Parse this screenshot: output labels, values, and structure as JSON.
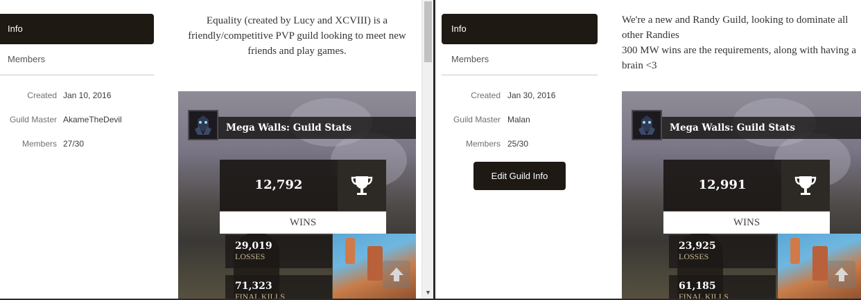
{
  "left_guild": {
    "nav": {
      "info_label": "Info",
      "members_label": "Members"
    },
    "meta": [
      {
        "key": "Created",
        "value": "Jan 10, 2016"
      },
      {
        "key": "Guild Master",
        "value": "AkameTheDevil"
      },
      {
        "key": "Members",
        "value": "27/30"
      }
    ],
    "description": "Equality (created by Lucy and XCVIII) is a friendly/competitive PVP guild looking to meet new friends and play games.",
    "stats_card": {
      "title": "Mega Walls: Guild Stats",
      "wins_value": "12,792",
      "wins_label": "WINS",
      "losses_value": "29,019",
      "losses_label": "LOSSES",
      "final_kills_value": "71,323",
      "final_kills_label": "FINAL KILLS"
    }
  },
  "right_guild": {
    "nav": {
      "info_label": "Info",
      "members_label": "Members"
    },
    "meta": [
      {
        "key": "Created",
        "value": "Jan 30, 2016"
      },
      {
        "key": "Guild Master",
        "value": "Malan"
      },
      {
        "key": "Members",
        "value": "25/30"
      }
    ],
    "edit_button_label": "Edit Guild Info",
    "description_lines": [
      "We're a new and Randy Guild, looking to dominate all other Randies",
      "300 MW wins are the requirements, along with having a brain <3"
    ],
    "stats_card": {
      "title": "Mega Walls: Guild Stats",
      "wins_value": "12,991",
      "wins_label": "WINS",
      "losses_value": "23,925",
      "losses_label": "LOSSES",
      "final_kills_value": "61,185",
      "final_kills_label": "FINAL KILLS"
    }
  },
  "icons": {
    "emblem": "guild-emblem-icon",
    "trophy": "trophy-icon",
    "scroll_top": "arrow-up-icon"
  },
  "colors": {
    "nav_active_bg": "#1e1913",
    "stat_label": "#c8b88f",
    "card_dark": "#1c1816"
  }
}
